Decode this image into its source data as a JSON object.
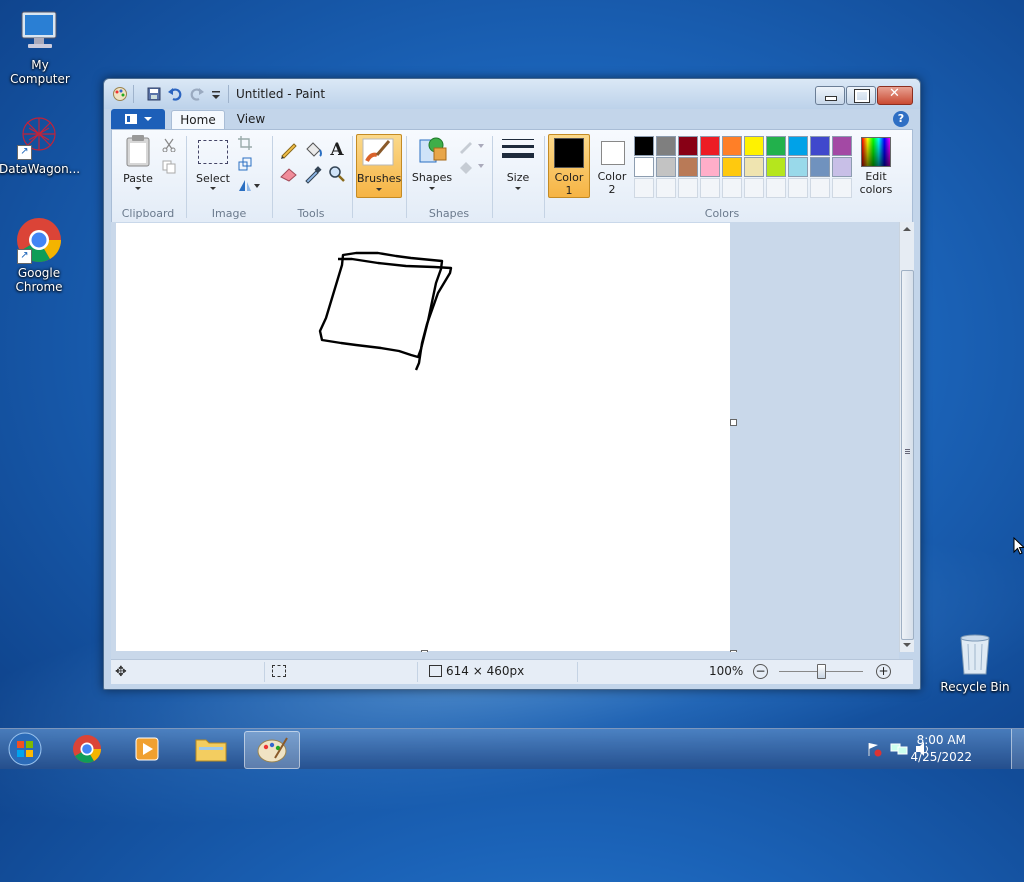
{
  "desktop": {
    "icons": [
      {
        "label": "My Computer"
      },
      {
        "label": "DataWagon..."
      },
      {
        "label": "Google Chrome"
      },
      {
        "label": "Recycle Bin"
      }
    ]
  },
  "window": {
    "title": "Untitled - Paint",
    "tabs": [
      {
        "label": "Home",
        "active": true
      },
      {
        "label": "View",
        "active": false
      }
    ],
    "clipboard": {
      "paste": "Paste",
      "group": "Clipboard"
    },
    "image": {
      "select": "Select",
      "group": "Image"
    },
    "tools": {
      "group": "Tools",
      "text_tool": "A"
    },
    "brushes": {
      "label": "Brushes"
    },
    "shapes": {
      "label": "Shapes",
      "group": "Shapes"
    },
    "size": {
      "label": "Size"
    },
    "colors": {
      "color1": "Color",
      "color1_num": "1",
      "color2": "Color",
      "color2_num": "2",
      "edit_colors": "Edit",
      "edit_colors_2": "colors",
      "group": "Colors",
      "palette_row1": [
        "#000000",
        "#7f7f7f",
        "#880015",
        "#ed1c24",
        "#ff7f27",
        "#fff200",
        "#22b14c",
        "#00a2e8",
        "#3f48cc",
        "#a349a4"
      ],
      "palette_row2": [
        "#ffffff",
        "#c3c3c3",
        "#b97a57",
        "#ffaec9",
        "#ffc90e",
        "#efe4b0",
        "#b5e61d",
        "#99d9ea",
        "#7092be",
        "#c8bfe7"
      ],
      "color1_value": "#000000",
      "color2_value": "#ffffff"
    },
    "status": {
      "dimensions": "614 × 460px",
      "zoom": "100%"
    }
  },
  "taskbar": {
    "time": "8:00 AM",
    "date": "4/25/2022"
  }
}
